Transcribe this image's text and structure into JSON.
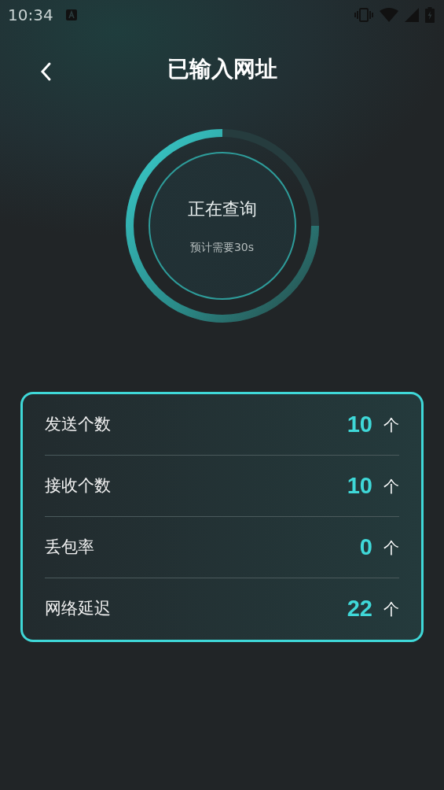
{
  "status_bar": {
    "time": "10:34"
  },
  "header": {
    "title": "已输入网址"
  },
  "progress": {
    "status": "正在查询",
    "estimate": "预计需要30s"
  },
  "stats": [
    {
      "label": "发送个数",
      "value": "10",
      "unit": "个"
    },
    {
      "label": "接收个数",
      "value": "10",
      "unit": "个"
    },
    {
      "label": "丢包率",
      "value": "0",
      "unit": "个"
    },
    {
      "label": "网络延迟",
      "value": "22",
      "unit": "个"
    }
  ]
}
